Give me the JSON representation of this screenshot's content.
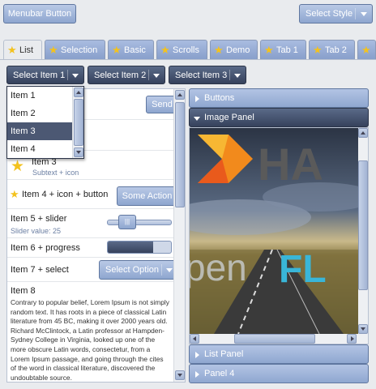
{
  "toolbar": {
    "menubar_button": "Menubar Button",
    "select_style": "Select Style"
  },
  "tabs": [
    {
      "label": "List",
      "active": true
    },
    {
      "label": "Selection"
    },
    {
      "label": "Basic"
    },
    {
      "label": "Scrolls"
    },
    {
      "label": "Demo"
    },
    {
      "label": "Tab 1"
    },
    {
      "label": "Tab 2"
    }
  ],
  "selects": {
    "item1": "Select Item 1",
    "item2": "Select Item 2",
    "item3": "Select Item 3"
  },
  "dropdown": {
    "items": [
      "Item 1",
      "Item 2",
      "Item 3",
      "Item 4"
    ],
    "selected": "Item 3"
  },
  "list": {
    "send_label": "Send",
    "item3_partial": "Item 3",
    "subtext_icon": "Subtext + icon",
    "item4_label": "Item 4 + icon + button",
    "some_action": "Some Action",
    "item5_label": "Item 5 + slider",
    "slider_value_text": "Slider value: 25",
    "slider_value": 25,
    "item6_label": "Item 6 + progress",
    "progress_fraction": 0.72,
    "item7_label": "Item 7 + select",
    "select_option": "Select Option",
    "item8_label": "Item 8",
    "lorem": "Contrary to popular belief, Lorem Ipsum is not simply random text. It has roots in a piece of classical Latin literature from 45 BC, making it over 2000 years old. Richard McClintock, a Latin professor at Hampden-Sydney College in Virginia, looked up one of the more obscure Latin words, consectetur, from a Lorem Ipsum passage, and going through the cites of the word in classical literature, discovered the undoubtable source."
  },
  "accordion": {
    "buttons": "Buttons",
    "image_panel": "Image Panel",
    "list_panel": "List Panel",
    "panel4": "Panel 4"
  },
  "image": {
    "brand_text": "HA",
    "fl_text": "FL",
    "pen_text": "pen"
  },
  "colors": {
    "accent": "#8ea6cf",
    "dark": "#3f4b66",
    "star": "#f3c21e"
  }
}
